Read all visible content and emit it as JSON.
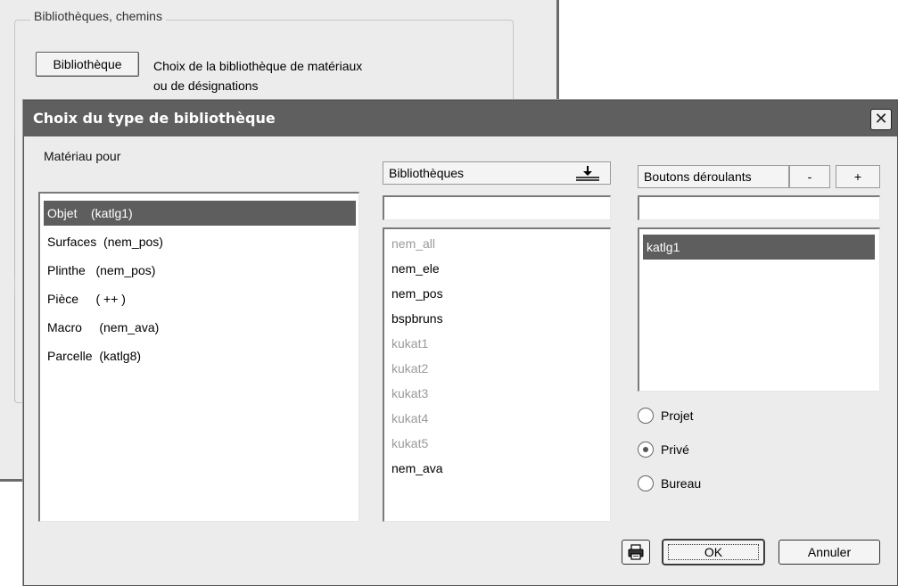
{
  "background": {
    "group_title": "Bibliothèques, chemins",
    "library_button": "Bibliothèque",
    "library_desc_line1": "Choix de la bibliothèque de matériaux",
    "library_desc_line2": "ou de désignations"
  },
  "dialog": {
    "title": "Choix du type de bibliothèque",
    "close_icon": "close-icon"
  },
  "material_panel": {
    "label": "Matériau pour",
    "items": [
      {
        "label": "Objet    (katlg1)",
        "selected": true
      },
      {
        "label": "Surfaces  (nem_pos)",
        "selected": false
      },
      {
        "label": "Plinthe   (nem_pos)",
        "selected": false
      },
      {
        "label": "Pièce     ( ++ )",
        "selected": false
      },
      {
        "label": "Macro     (nem_ava)",
        "selected": false
      },
      {
        "label": "Parcelle  (katlg8)",
        "selected": false
      }
    ]
  },
  "libraries_panel": {
    "label": "Bibliothèques",
    "import_icon": "download-icon",
    "filter_value": "",
    "items": [
      {
        "label": "nem_all",
        "enabled": false
      },
      {
        "label": "nem_ele",
        "enabled": true
      },
      {
        "label": "nem_pos",
        "enabled": true
      },
      {
        "label": "bspbruns",
        "enabled": true
      },
      {
        "label": "kukat1",
        "enabled": false
      },
      {
        "label": "kukat2",
        "enabled": false
      },
      {
        "label": "kukat3",
        "enabled": false
      },
      {
        "label": "kukat4",
        "enabled": false
      },
      {
        "label": "kukat5",
        "enabled": false
      },
      {
        "label": "nem_ava",
        "enabled": true
      }
    ]
  },
  "buttons_panel": {
    "label": "Boutons déroulants",
    "minus": "-",
    "plus": "+",
    "filter_value": "",
    "items": [
      {
        "label": "katlg1",
        "selected": true
      }
    ]
  },
  "scope": {
    "options": [
      {
        "label": "Projet",
        "checked": false
      },
      {
        "label": "Privé",
        "checked": true
      },
      {
        "label": "Bureau",
        "checked": false
      }
    ]
  },
  "footer": {
    "print_icon": "printer-icon",
    "ok": "OK",
    "cancel": "Annuler"
  },
  "colors": {
    "titlebar": "#5f5f5f",
    "selection": "#5e5e5e",
    "disabled_text": "#9a9a9a"
  }
}
